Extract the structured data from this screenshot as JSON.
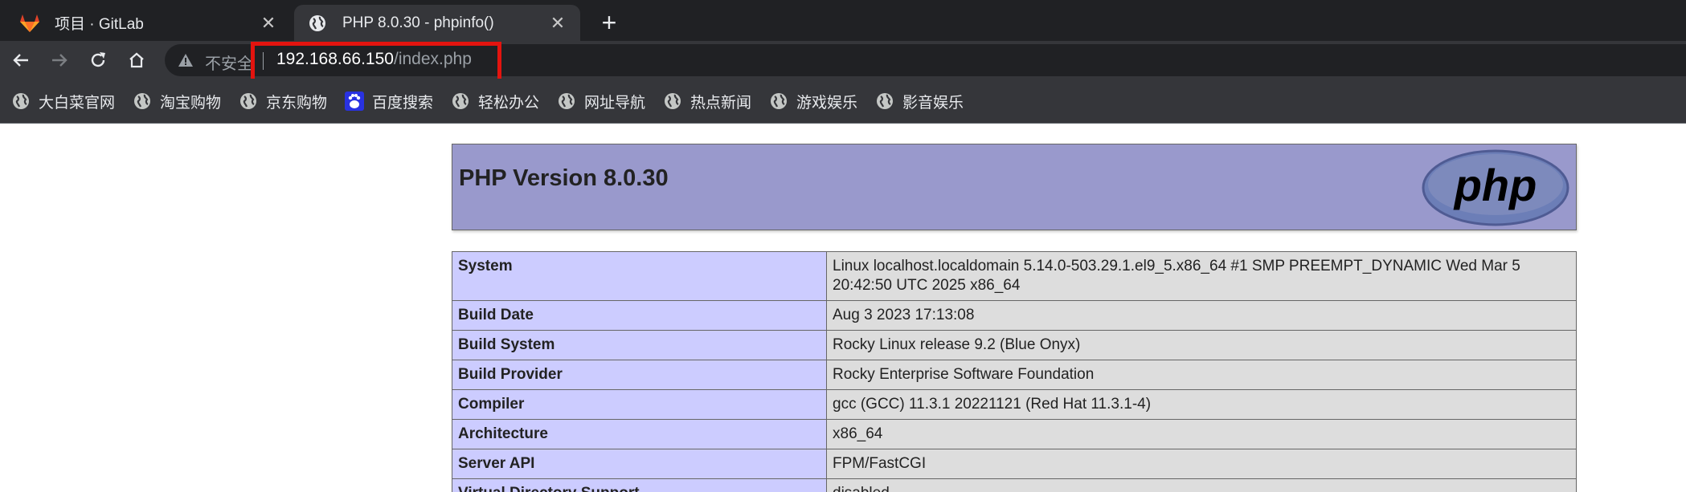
{
  "tabs": [
    {
      "title": "项目 · GitLab",
      "favicon": "gitlab-icon",
      "active": false
    },
    {
      "title": "PHP 8.0.30 - phpinfo()",
      "favicon": "globe-icon",
      "active": true
    }
  ],
  "toolbar": {
    "security_label": "不安全",
    "url_host": "192.168.66.150",
    "url_path": "/index.php"
  },
  "bookmarks": [
    {
      "label": "大白菜官网",
      "icon": "globe-icon"
    },
    {
      "label": "淘宝购物",
      "icon": "globe-icon"
    },
    {
      "label": "京东购物",
      "icon": "globe-icon"
    },
    {
      "label": "百度搜索",
      "icon": "baidu-icon"
    },
    {
      "label": "轻松办公",
      "icon": "globe-icon"
    },
    {
      "label": "网址导航",
      "icon": "globe-icon"
    },
    {
      "label": "热点新闻",
      "icon": "globe-icon"
    },
    {
      "label": "游戏娱乐",
      "icon": "globe-icon"
    },
    {
      "label": "影音娱乐",
      "icon": "globe-icon"
    }
  ],
  "page": {
    "title": "PHP Version 8.0.30",
    "logo_text": "php",
    "rows": [
      {
        "key": "System",
        "value": "Linux localhost.localdomain 5.14.0-503.29.1.el9_5.x86_64 #1 SMP PREEMPT_DYNAMIC Wed Mar 5 20:42:50 UTC 2025 x86_64"
      },
      {
        "key": "Build Date",
        "value": "Aug 3 2023 17:13:08"
      },
      {
        "key": "Build System",
        "value": "Rocky Linux release 9.2 (Blue Onyx)"
      },
      {
        "key": "Build Provider",
        "value": "Rocky Enterprise Software Foundation"
      },
      {
        "key": "Compiler",
        "value": "gcc (GCC) 11.3.1 20221121 (Red Hat 11.3.1-4)"
      },
      {
        "key": "Architecture",
        "value": "x86_64"
      },
      {
        "key": "Server API",
        "value": "FPM/FastCGI"
      },
      {
        "key": "Virtual Directory Support",
        "value": "disabled"
      }
    ]
  },
  "colors": {
    "tabstrip": "#202124",
    "toolbar": "#35363a",
    "highlight_box": "#e3140f",
    "php_header": "#9999cc",
    "key_cell": "#ccccff",
    "value_cell": "#dddddd"
  }
}
